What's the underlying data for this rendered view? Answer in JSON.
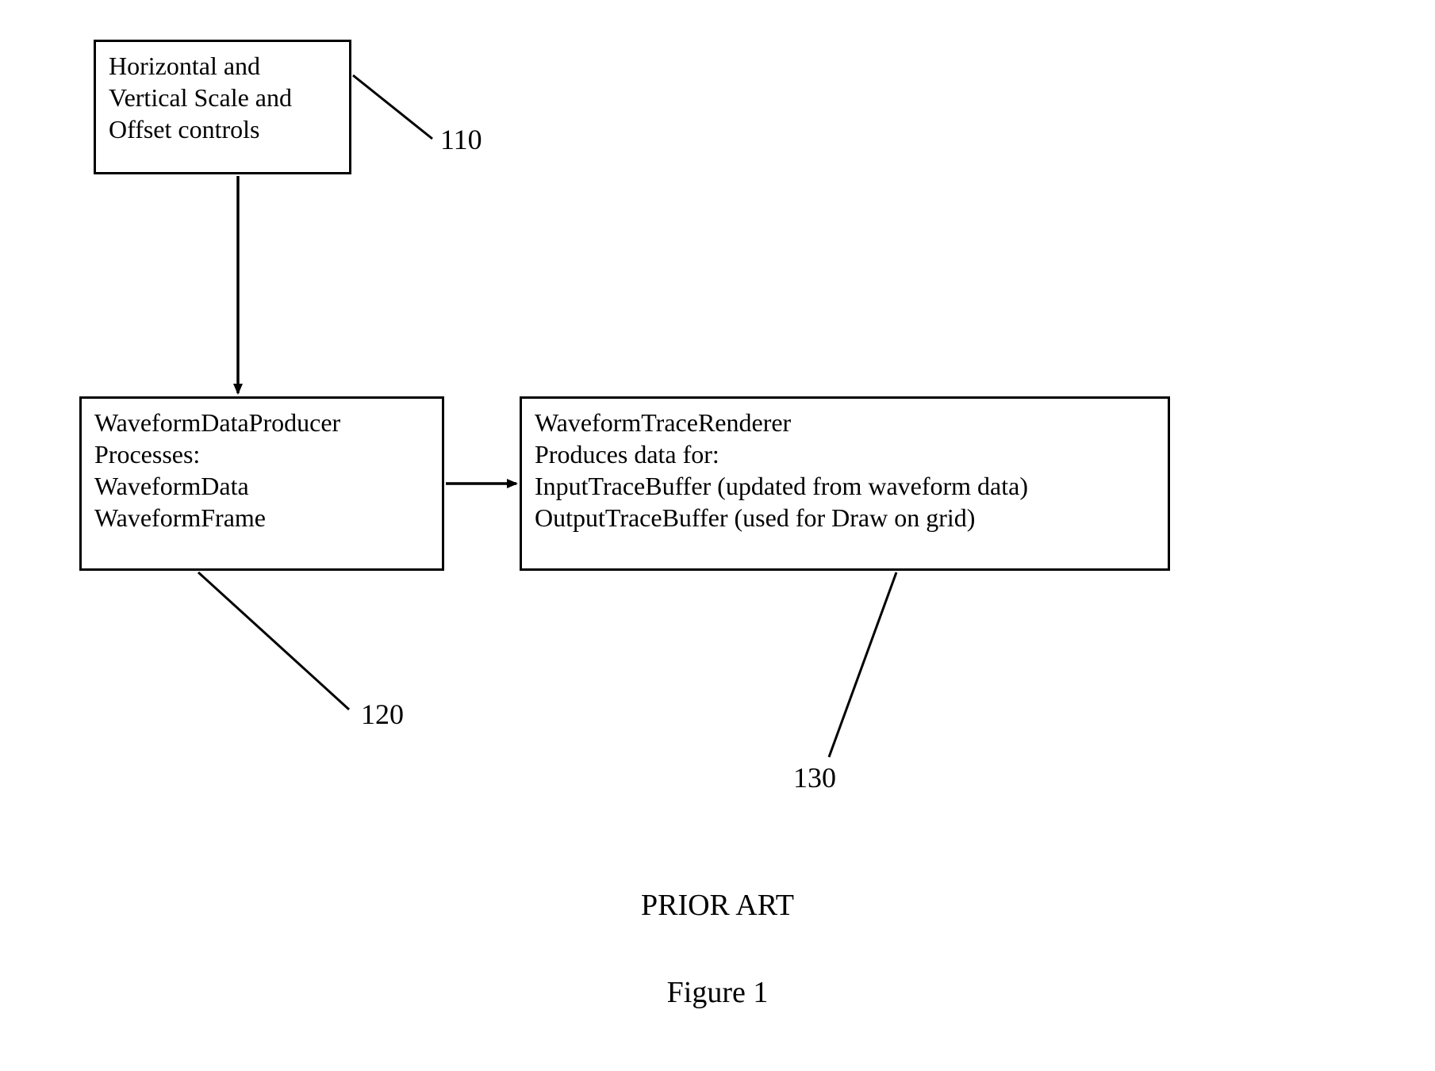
{
  "boxes": {
    "controls": {
      "line1": "Horizontal and",
      "line2": "Vertical Scale and",
      "line3": "Offset controls"
    },
    "producer": {
      "line1": "WaveformDataProducer",
      "line2": "Processes:",
      "line3": "WaveformData",
      "line4": "WaveformFrame"
    },
    "renderer": {
      "line1": "WaveformTraceRenderer",
      "line2": "Produces data for:",
      "line3": "InputTraceBuffer (updated from waveform data)",
      "line4": "OutputTraceBuffer (used for Draw on grid)"
    }
  },
  "labels": {
    "controls_ref": "110",
    "producer_ref": "120",
    "renderer_ref": "130"
  },
  "captions": {
    "prior_art": "PRIOR ART",
    "figure": "Figure 1"
  }
}
